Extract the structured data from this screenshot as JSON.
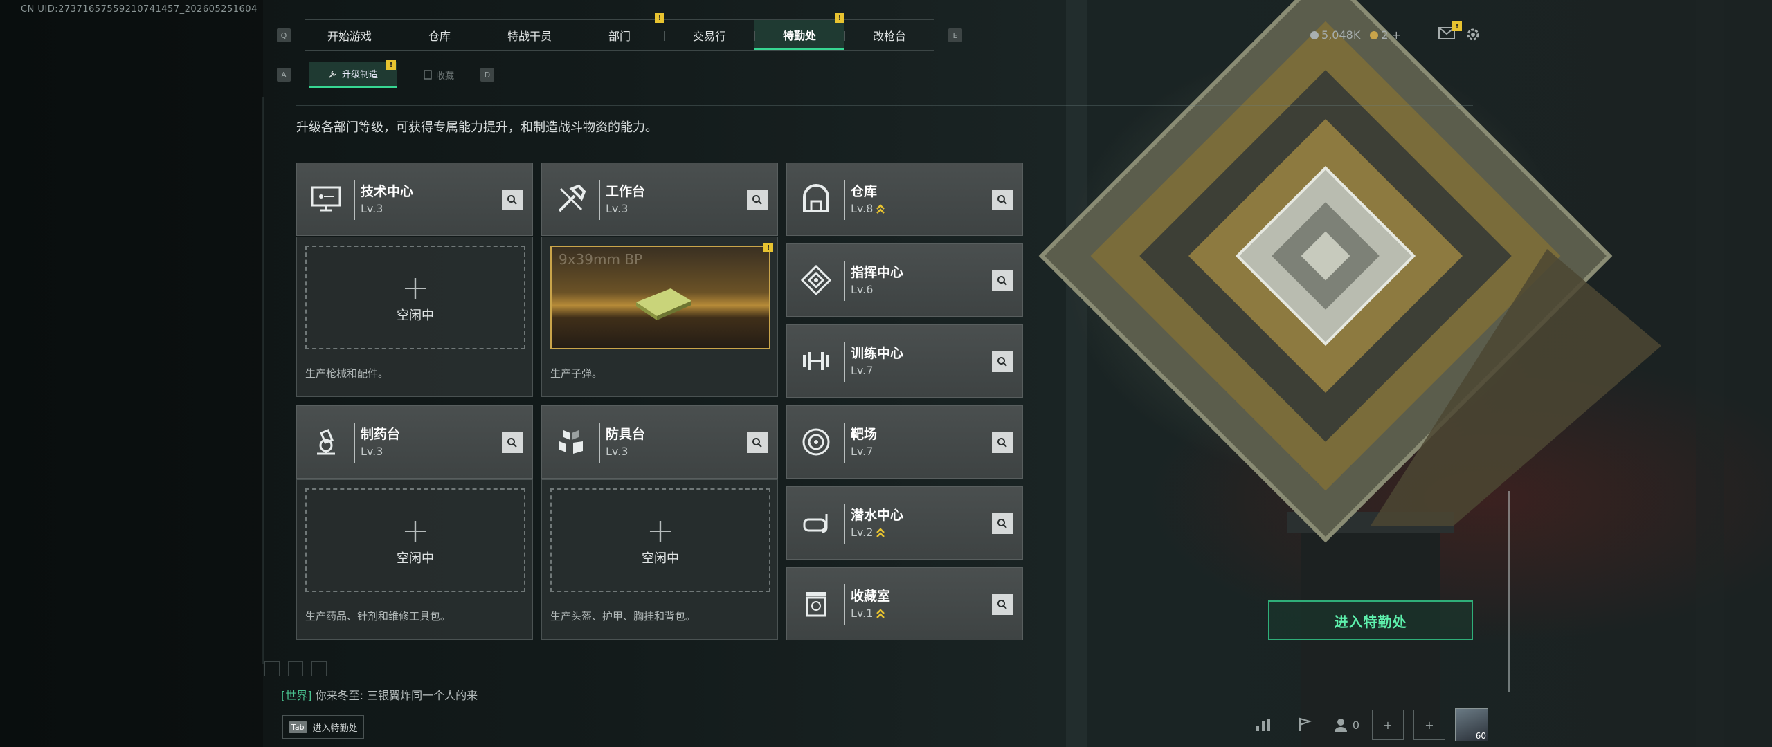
{
  "uid": "CN UID:2737165755921074145​7_202605251604",
  "nav": {
    "left_key": "Q",
    "right_key": "E",
    "tabs": [
      {
        "label": "开始游戏",
        "badge": ""
      },
      {
        "label": "仓库",
        "badge": ""
      },
      {
        "label": "特战干员",
        "badge": ""
      },
      {
        "label": "部门",
        "badge": "!"
      },
      {
        "label": "交易行",
        "badge": ""
      },
      {
        "label": "特勤处",
        "badge": "!",
        "active": true
      },
      {
        "label": "改枪台",
        "badge": ""
      }
    ]
  },
  "subnav": {
    "left_key": "A",
    "right_key": "D",
    "tabs": [
      {
        "label": "升级制造",
        "badge": "!",
        "active": true
      },
      {
        "label": "收藏",
        "badge": ""
      }
    ]
  },
  "resources": {
    "currency": "5,048K",
    "tokens": "2",
    "plus": "+",
    "mail_badge": "!"
  },
  "description": "升级各部门等级，可获得专属能力提升，和制造战斗物资的能力。",
  "facilities": [
    {
      "name": "技术中心",
      "level": "Lv.3",
      "icon": "computer-icon",
      "upgradable": false
    },
    {
      "name": "工作台",
      "level": "Lv.3",
      "icon": "tools-icon",
      "upgradable": false
    },
    {
      "name": "仓库",
      "level": "Lv.8",
      "icon": "warehouse-icon",
      "upgradable": true
    },
    {
      "name": "指挥中心",
      "level": "Lv.6",
      "icon": "command-icon",
      "upgradable": false
    },
    {
      "name": "训练中心",
      "level": "Lv.7",
      "icon": "dumbbell-icon",
      "upgradable": false
    },
    {
      "name": "制药台",
      "level": "Lv.3",
      "icon": "microscope-icon",
      "upgradable": false
    },
    {
      "name": "防具台",
      "level": "Lv.3",
      "icon": "armor-icon",
      "upgradable": false
    },
    {
      "name": "靶场",
      "level": "Lv.7",
      "icon": "target-icon",
      "upgradable": false
    },
    {
      "name": "潜水中心",
      "level": "Lv.2",
      "icon": "diving-icon",
      "upgradable": true
    },
    {
      "name": "收藏室",
      "level": "Lv.1",
      "icon": "collection-icon",
      "upgradable": true
    }
  ],
  "production": [
    {
      "status": "空闲中",
      "plus": "+",
      "caption": "生产枪械和配件。"
    },
    {
      "item": "9x39mm BP",
      "caption": "生产子弹。",
      "badge": "!"
    },
    {
      "status": "空闲中",
      "plus": "+",
      "caption": "生产药品、针剂和维修工具包。"
    },
    {
      "status": "空闲中",
      "plus": "+",
      "caption": "生产头盔、护甲、胸挂和背包。"
    }
  ],
  "enter_button": "进入特勤处",
  "chat": {
    "channel": "[世界]",
    "message": "你来冬至: 三银翼炸同一个人的来"
  },
  "tab_hint": {
    "key": "Tab",
    "label": "进入特勤处"
  },
  "bottom": {
    "friends_count": "0",
    "avatar_level": "60"
  },
  "colors": {
    "accent": "#37d692",
    "badge": "#e8c330",
    "card": "#464b4b"
  }
}
